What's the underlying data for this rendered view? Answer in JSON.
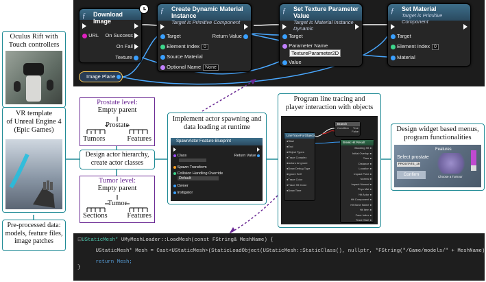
{
  "blueprint": {
    "download_node": {
      "title": "Download Image",
      "pins_left": [
        "URL"
      ],
      "pins_right": [
        "On Success",
        "On Fail",
        "Texture"
      ]
    },
    "create_node": {
      "title": "Create Dynamic Material Instance",
      "subtitle": "Target is Primitive Component",
      "pins_left": [
        "Target",
        "Element Index",
        "Source Material",
        "Optional Name"
      ],
      "element_index": "0",
      "optional_name": "None",
      "pin_right": "Return Value"
    },
    "set_param_node": {
      "title": "Set Texture Parameter Value",
      "subtitle": "Target is Material Instance Dynamic",
      "pins": [
        "Target",
        "Parameter Name",
        "Value"
      ],
      "param_value": "TextureParameter2D"
    },
    "set_material_node": {
      "title": "Set Material",
      "subtitle": "Target is Primitive Component",
      "pins": [
        "Target",
        "Element Index",
        "Material"
      ],
      "element_index": "0"
    },
    "image_plane": "Image Plane"
  },
  "left": {
    "oculus": "Oculus Rift with Touch controllers",
    "vr_template": [
      "VR template",
      "of Unreal Engine 4",
      "(Epic Games)"
    ],
    "preprocessed": [
      "Pre-processed data:",
      "models, feature files,",
      "image patches"
    ]
  },
  "hierarchy": {
    "prostate_level": "Prostate level:",
    "prostate_parent": "Empty parent",
    "prostate": "Prostate",
    "tumors": "Tumors",
    "features": "Features",
    "design": [
      "Design actor hierarchy,",
      "create actor classes"
    ],
    "tumor_level": "Tumor level:",
    "tumor_parent": "Empty parent",
    "tumor": "Tumor",
    "sections": "Sections",
    "features2": "Features"
  },
  "spawn": {
    "caption": [
      "Implement actor spawning and",
      "data loading at runtime"
    ],
    "node_title": "SpawnActor Feature Blueprint",
    "pins": [
      "Class",
      "Spawn Transform",
      "Collision Handling Override",
      "Owner",
      "Instigator"
    ],
    "collision_value": "Default",
    "return": "Return Value"
  },
  "trace": {
    "caption": [
      "Program line tracing and",
      "player interaction with objects"
    ],
    "node1": "LineTraceForObjects",
    "node2": "Branch",
    "node3": "Break Hit Result",
    "branch_pins": [
      "Condition",
      "True",
      "False"
    ]
  },
  "widget": {
    "caption": [
      "Design widget based menus,",
      "program functionalities"
    ],
    "features_label": "Features",
    "select_label": "Select prostate",
    "confirm": "Confirm",
    "dropdown_value": "PROSTATE_18",
    "choose_label": "Choose a Tumour"
  },
  "code": {
    "line1_type": "UStaticMesh*",
    "line1_rest": " UMyMeshLoader::LoadMesh(const FString& MeshName) {",
    "line2": "UStaticMesh* Mesh = Cast<UStaticMesh>(StaticLoadObject(UStaticMesh::StaticClass(), nullptr, *FString(\"/Game/models/\" + MeshName)));",
    "line3": "return Mesh;",
    "line4": "}"
  },
  "colors": {
    "teal": "#1f8a95",
    "purple": "#6b2a94",
    "blueprint_bg": "#1c1c1c"
  }
}
